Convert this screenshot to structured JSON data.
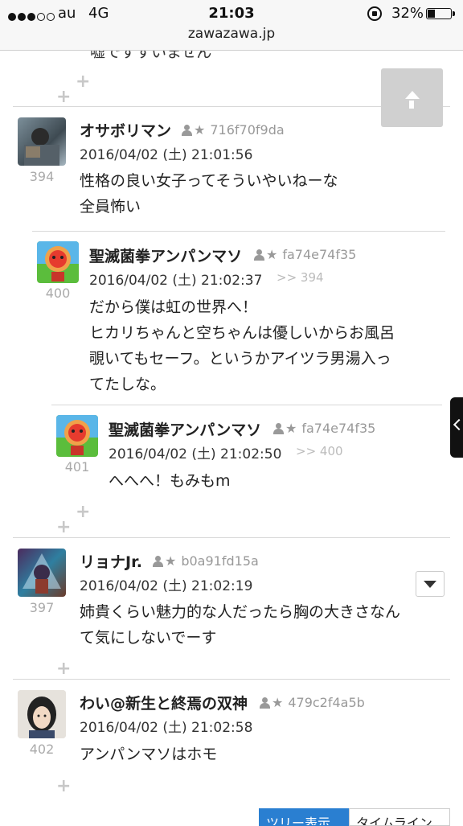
{
  "status_bar": {
    "carrier": "au",
    "network": "4G",
    "time": "21:03",
    "battery": "32%",
    "url": "zawazawa.jp"
  },
  "top_fragment": "嘘ですすいません",
  "comments": [
    {
      "num": "394",
      "name": "オサボリマン",
      "id": "716f70f9da",
      "date": "2016/04/02 (土) 21:01:56",
      "reply_to": "",
      "body": "性格の良い女子ってそういやいねーな\n全員怖い"
    },
    {
      "num": "400",
      "name": "聖滅菌拳アンパンマソ",
      "id": "fa74e74f35",
      "date": "2016/04/02 (土) 21:02:37",
      "reply_to": ">> 394",
      "body": "だから僕は虹の世界へ！\nヒカリちゃんと空ちゃんは優しいからお風呂\n覗いてもセーフ。というかアイツラ男湯入っ\nてたしな。"
    },
    {
      "num": "401",
      "name": "聖滅菌拳アンパンマソ",
      "id": "fa74e74f35",
      "date": "2016/04/02 (土) 21:02:50",
      "reply_to": ">> 400",
      "body": "へへへ！もみもm"
    },
    {
      "num": "397",
      "name": "リョナJr.",
      "id": "b0a91fd15a",
      "date": "2016/04/02 (土) 21:02:19",
      "reply_to": "",
      "body": "姉貴くらい魅力的な人だったら胸の大きさなん\nて気にしないでーす"
    },
    {
      "num": "402",
      "name": "わい@新生と終焉の双神",
      "id": "479c2f4a5b",
      "date": "2016/04/02 (土) 21:02:58",
      "reply_to": "",
      "body": "アンパンマソはホモ"
    }
  ],
  "tabs": [
    "ツリー表示",
    "タイムライン"
  ],
  "plus_label": "+",
  "star_glyph": "★"
}
